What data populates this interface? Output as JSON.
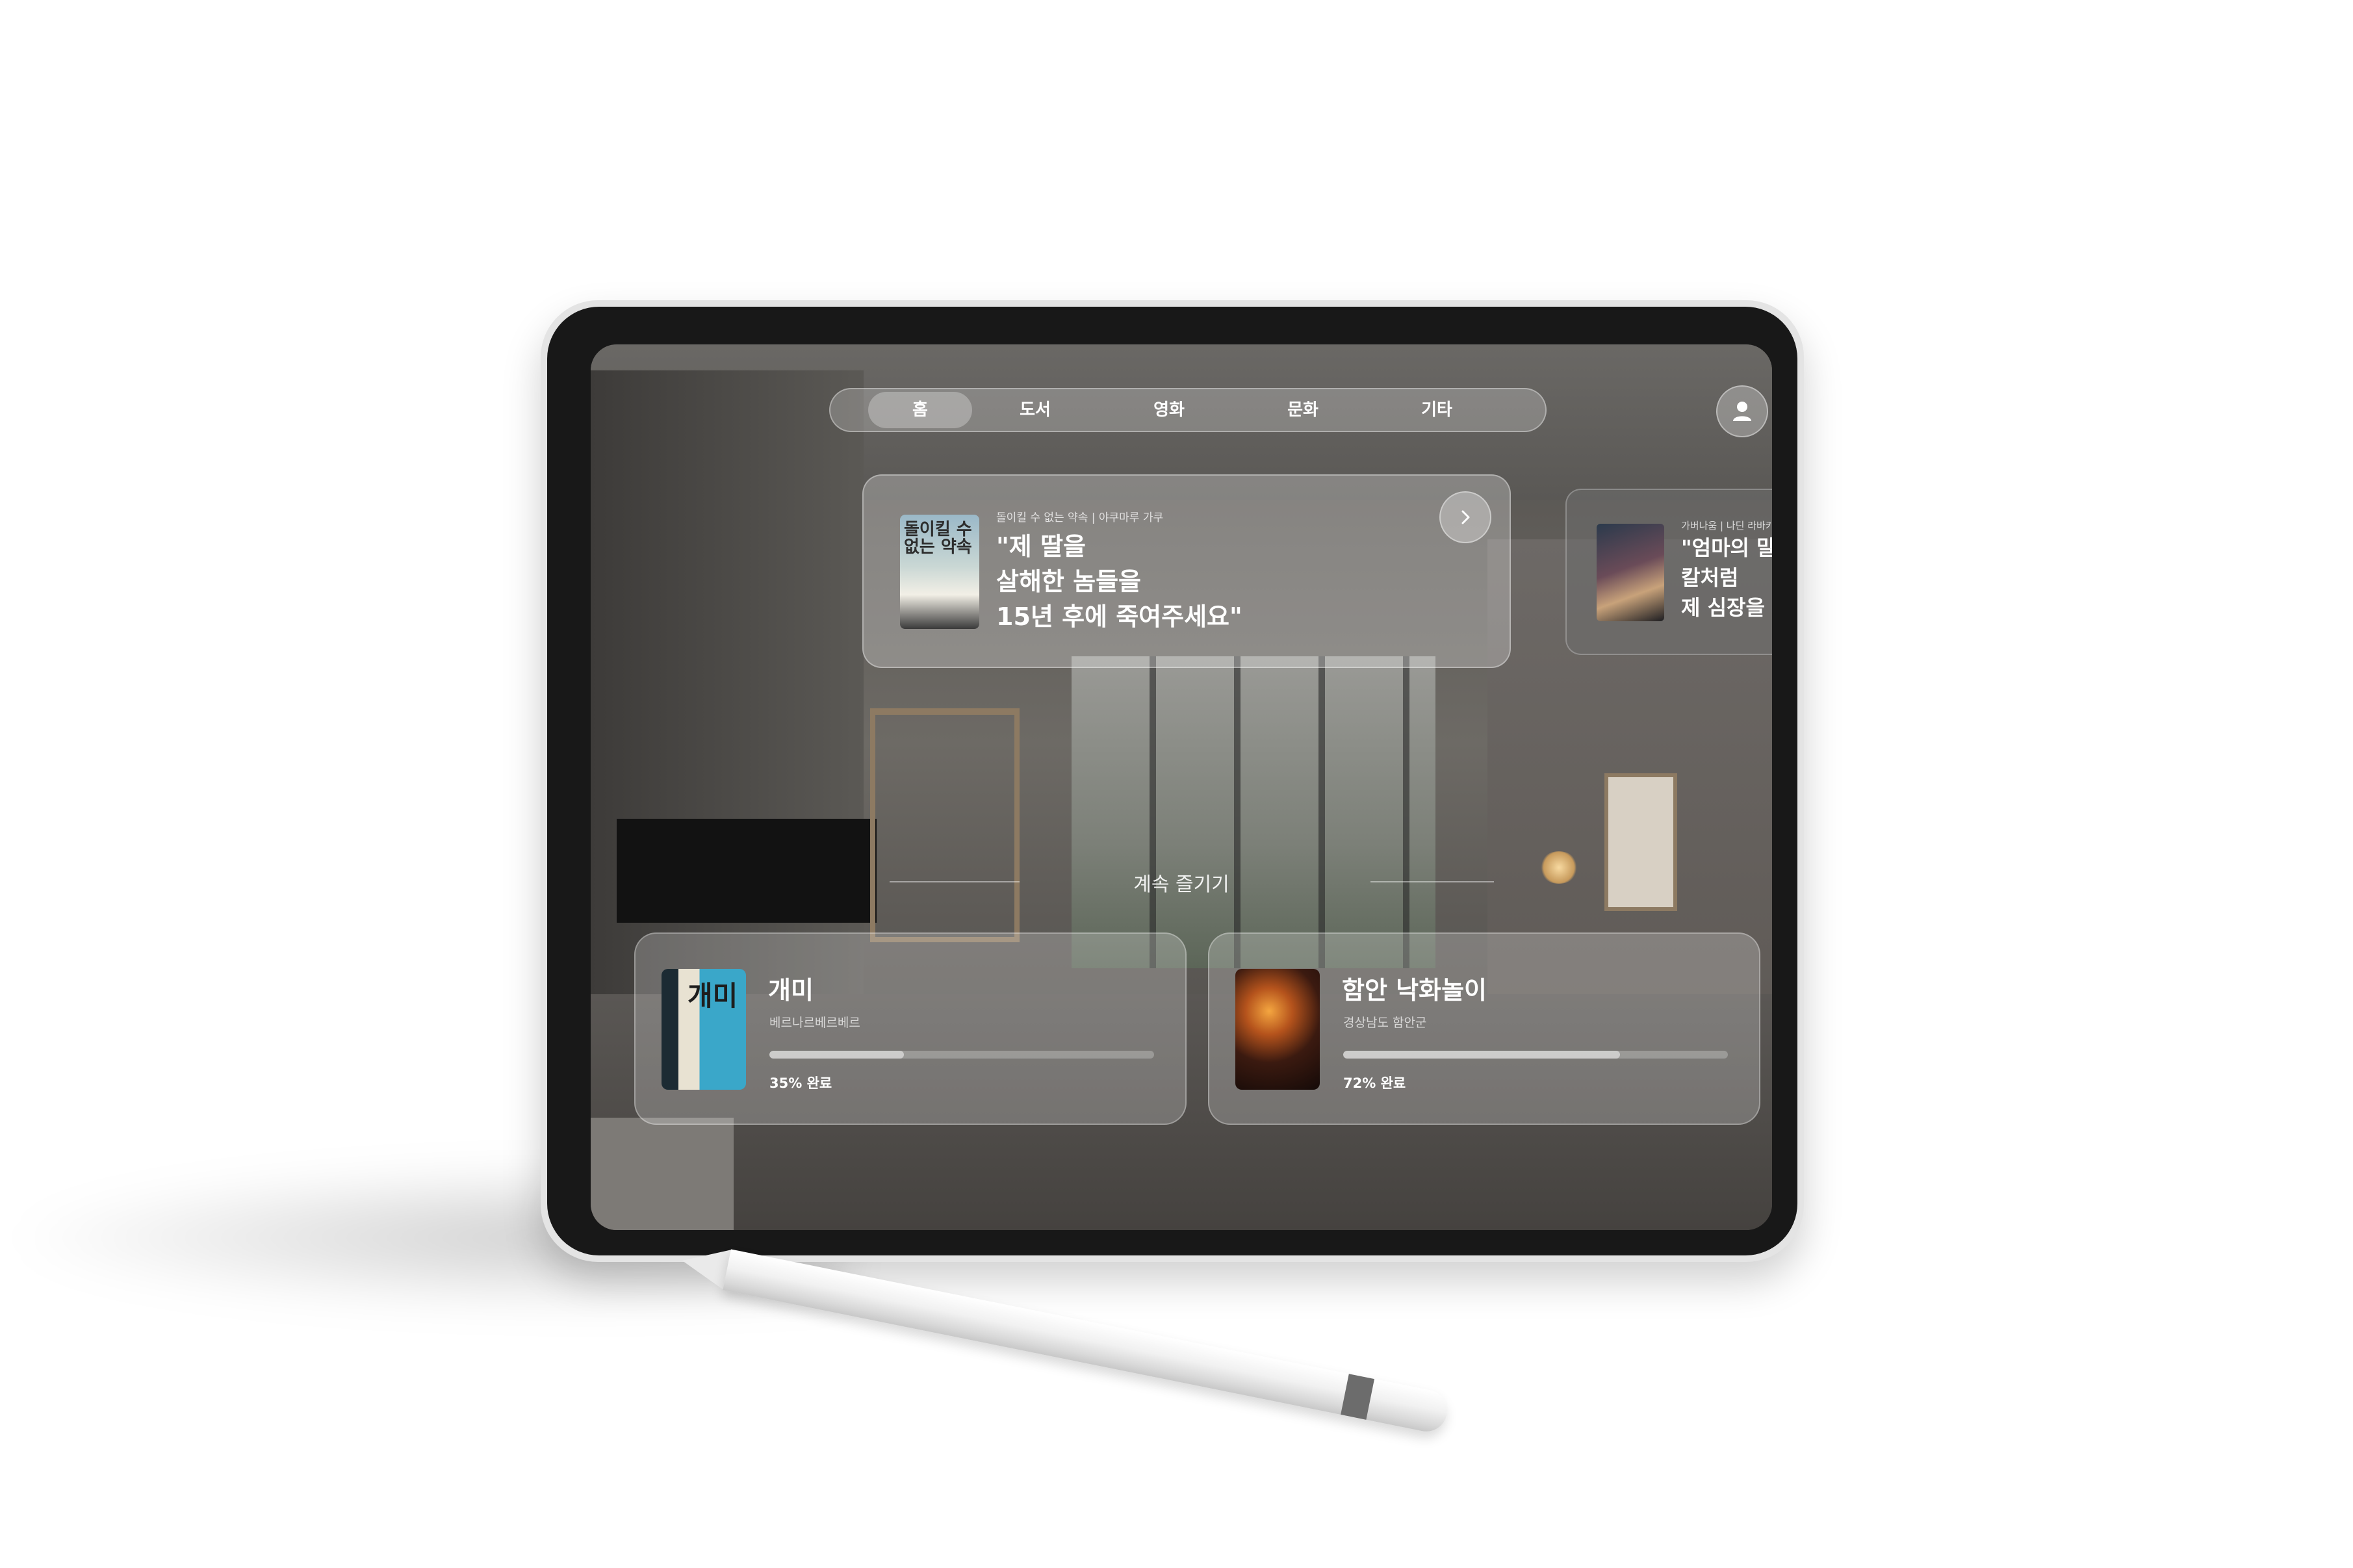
{
  "nav": {
    "items": [
      {
        "label": "홈",
        "active": true
      },
      {
        "label": "도서",
        "active": false
      },
      {
        "label": "영화",
        "active": false
      },
      {
        "label": "문화",
        "active": false
      },
      {
        "label": "기타",
        "active": false
      }
    ]
  },
  "featured": [
    {
      "meta": "돌이킬 수 없는 약속 | 야쿠마루 가쿠",
      "quote_lines": [
        "\"제 딸을",
        "살해한 놈들을",
        "15년 후에 죽여주세요\""
      ],
      "cover_text": "돌이킬 수 없는 약속"
    },
    {
      "meta": "가버나움 | 나딘 라바키",
      "quote_lines": [
        "\"엄마의 말이",
        "칼처럼",
        "제 심장을 찔"
      ]
    }
  ],
  "section": {
    "title": "계속 즐기기"
  },
  "continue": [
    {
      "title": "개미",
      "subtitle": "베르나르베르베르",
      "progress": 0.35,
      "progress_label": "35% 완료",
      "cover_text": "개미"
    },
    {
      "title": "함안 낙화놀이",
      "subtitle": "경상남도 함안군",
      "progress": 0.72,
      "progress_label": "72% 완료"
    }
  ],
  "colors": {
    "accent": "#ffffff",
    "glass": "rgba(255,255,255,0.24)"
  }
}
